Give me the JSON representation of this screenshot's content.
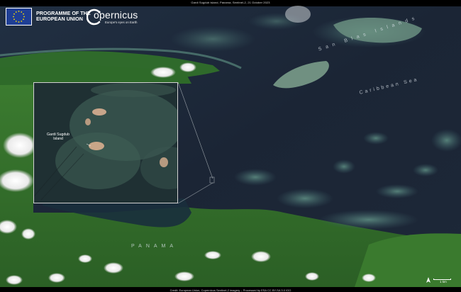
{
  "top_caption": "Gardi Sugdub island, Panama, Sentinel-2, 21 October 2023",
  "bottom_caption": "Credit: European Union, Copernicus Sentinel-2 imagery – Processed by ESA CC BY-SA 3.0 IGO",
  "logos": {
    "eu_line1": "PROGRAMME OF THE",
    "eu_line2": "EUROPEAN UNION",
    "copernicus_name": "opernicus",
    "copernicus_tagline": "Europe's eyes on Earth"
  },
  "labels": {
    "archipelago": "San Blas Islands",
    "sea": "Caribbean Sea",
    "country": "PANAMA",
    "inset_line1": "Gardi Sugdub",
    "inset_line2": "Island"
  },
  "scale": {
    "text": "1 km",
    "north": "N"
  },
  "colors": {
    "sea_dark": "#1a2433",
    "sea_mid": "#233447",
    "reef": "#4f7a7a",
    "land": "#2f6b2a",
    "land_light": "#4a8a34",
    "cloud": "#f2f2f2",
    "eu_blue": "#1f3f95",
    "eu_star": "#ffdd00"
  }
}
